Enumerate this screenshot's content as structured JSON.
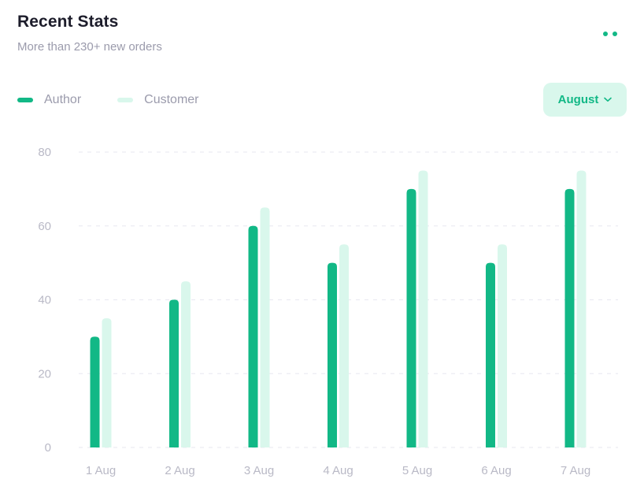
{
  "header": {
    "title": "Recent Stats",
    "subtitle": "More than 230+ new orders"
  },
  "menu_icon": "more-dots-icon",
  "month_selector": {
    "value": "August",
    "icon": "chevron-down-icon"
  },
  "colors": {
    "author": "#12b886",
    "customer": "#d9f7ec",
    "accent": "#12b886"
  },
  "chart_data": {
    "type": "bar",
    "title": "",
    "xlabel": "",
    "ylabel": "",
    "categories": [
      "1 Aug",
      "2 Aug",
      "3 Aug",
      "4 Aug",
      "5 Aug",
      "6 Aug",
      "7 Aug"
    ],
    "series": [
      {
        "name": "Author",
        "values": [
          30,
          40,
          60,
          50,
          70,
          50,
          70
        ]
      },
      {
        "name": "Customer",
        "values": [
          35,
          45,
          65,
          55,
          75,
          55,
          75
        ]
      }
    ],
    "ylim": [
      0,
      80
    ],
    "yticks": [
      0,
      20,
      40,
      60,
      80
    ],
    "grid": true,
    "gridStyle": "dashed",
    "legend": "top-left"
  }
}
